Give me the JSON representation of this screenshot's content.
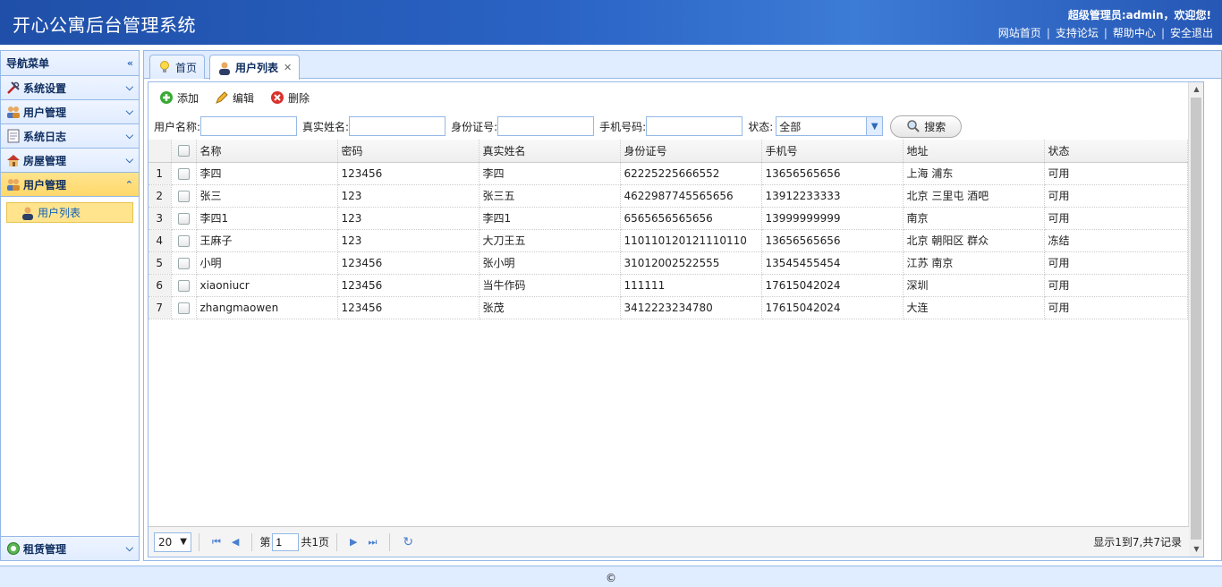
{
  "header": {
    "title": "开心公寓后台管理系统",
    "welcome": "超级管理员:admin，欢迎您!",
    "links": [
      "网站首页",
      "支持论坛",
      "帮助中心",
      "安全退出"
    ]
  },
  "sidebar": {
    "title": "导航菜单",
    "items": [
      {
        "label": "系统设置",
        "icon": "tools-icon"
      },
      {
        "label": "用户管理",
        "icon": "users-icon"
      },
      {
        "label": "系统日志",
        "icon": "log-icon"
      },
      {
        "label": "房屋管理",
        "icon": "house-icon"
      },
      {
        "label": "用户管理",
        "icon": "users-icon"
      }
    ],
    "sub_item": "用户列表",
    "bottom_item": "租赁管理"
  },
  "tabs": [
    {
      "label": "首页",
      "icon": "lightbulb-icon"
    },
    {
      "label": "用户列表",
      "icon": "user-icon"
    }
  ],
  "toolbar": {
    "add": "添加",
    "edit": "编辑",
    "delete": "删除"
  },
  "search": {
    "username_label": "用户名称:",
    "realname_label": "真实姓名:",
    "idcard_label": "身份证号:",
    "phone_label": "手机号码:",
    "status_label": "状态:",
    "status_value": "全部",
    "search_btn": "搜索"
  },
  "table": {
    "columns": [
      "名称",
      "密码",
      "真实姓名",
      "身份证号",
      "手机号",
      "地址",
      "状态"
    ],
    "rows": [
      [
        "1",
        "李四",
        "123456",
        "李四",
        "62225225666552",
        "13656565656",
        "上海 浦东",
        "可用"
      ],
      [
        "2",
        "张三",
        "123",
        "张三五",
        "4622987745565656",
        "13912233333",
        "北京 三里屯 酒吧",
        "可用"
      ],
      [
        "3",
        "李四1",
        "123",
        "李四1",
        "6565656565656",
        "13999999999",
        "南京",
        "可用"
      ],
      [
        "4",
        "王麻子",
        "123",
        "大刀王五",
        "110110120121110110",
        "13656565656",
        "北京 朝阳区 群众",
        "冻结"
      ],
      [
        "5",
        "小明",
        "123456",
        "张小明",
        "31012002522555",
        "13545455454",
        "江苏 南京",
        "可用"
      ],
      [
        "6",
        "xiaoniucr",
        "123456",
        "当牛作码",
        "111111",
        "17615042024",
        "深圳",
        "可用"
      ],
      [
        "7",
        "zhangmaowen",
        "123456",
        "张茂",
        "3412223234780",
        "17615042024",
        "大连",
        "可用"
      ]
    ]
  },
  "pager": {
    "page_size": "20",
    "page_prefix": "第",
    "page_value": "1",
    "page_suffix": "共1页",
    "info": "显示1到7,共7记录"
  },
  "footer": "©"
}
